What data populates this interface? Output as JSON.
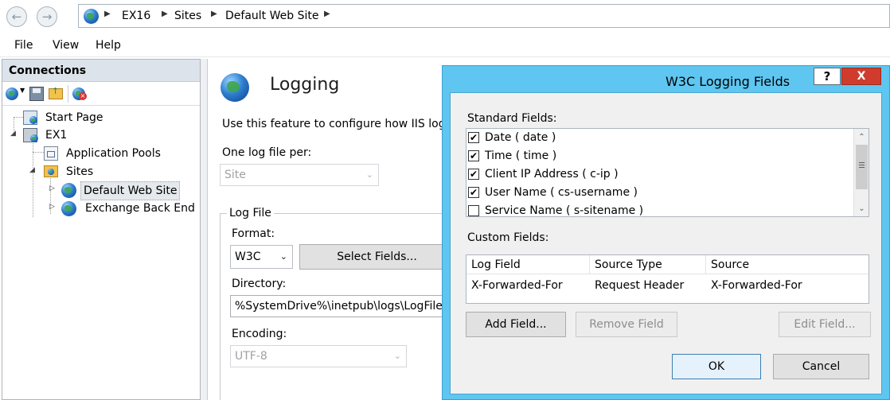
{
  "address_bar": {
    "back_icon": "back-arrow-icon",
    "forward_icon": "forward-arrow-icon",
    "breadcrumb": [
      "EX16",
      "Sites",
      "Default Web Site"
    ]
  },
  "menu": {
    "items": [
      "File",
      "View",
      "Help"
    ]
  },
  "connections": {
    "title": "Connections",
    "toolbar_icons": [
      "globe-connect-icon",
      "save-icon",
      "up-folder-icon",
      "disconnect-icon"
    ],
    "tree": [
      {
        "label": "Start Page",
        "icon": "start-page-icon"
      },
      {
        "label": "EX1",
        "icon": "server-icon"
      },
      {
        "label": "Application Pools",
        "icon": "app-pools-icon"
      },
      {
        "label": "Sites",
        "icon": "sites-folder-icon"
      },
      {
        "label": "Default Web Site",
        "icon": "web-site-icon"
      },
      {
        "label": "Exchange Back End",
        "icon": "web-site-icon"
      }
    ]
  },
  "main": {
    "title": "Logging",
    "description": "Use this feature to configure how IIS logs re",
    "one_log_file_label": "One log file per:",
    "one_log_file_value": "Site",
    "log_file_group": "Log File",
    "format_label": "Format:",
    "format_value": "W3C",
    "select_fields_button": "Select Fields...",
    "directory_label": "Directory:",
    "directory_value": "%SystemDrive%\\inetpub\\logs\\LogFiles",
    "encoding_label": "Encoding:",
    "encoding_value": "UTF-8"
  },
  "dialog": {
    "title": "W3C Logging Fields",
    "help_label": "?",
    "close_label": "X",
    "standard_fields_label": "Standard Fields:",
    "standard_fields": [
      {
        "label": "Date ( date )",
        "checked": true
      },
      {
        "label": "Time ( time )",
        "checked": true
      },
      {
        "label": "Client IP Address ( c-ip )",
        "checked": true
      },
      {
        "label": "User Name ( cs-username )",
        "checked": true
      },
      {
        "label": "Service Name ( s-sitename )",
        "checked": false
      }
    ],
    "custom_fields_label": "Custom Fields:",
    "custom_columns": [
      "Log Field",
      "Source Type",
      "Source"
    ],
    "custom_rows": [
      [
        "X-Forwarded-For",
        "Request Header",
        "X-Forwarded-For"
      ]
    ],
    "add_field_button": "Add Field...",
    "remove_field_button": "Remove Field",
    "edit_field_button": "Edit Field...",
    "ok_button": "OK",
    "cancel_button": "Cancel",
    "check_mark": "✔"
  }
}
